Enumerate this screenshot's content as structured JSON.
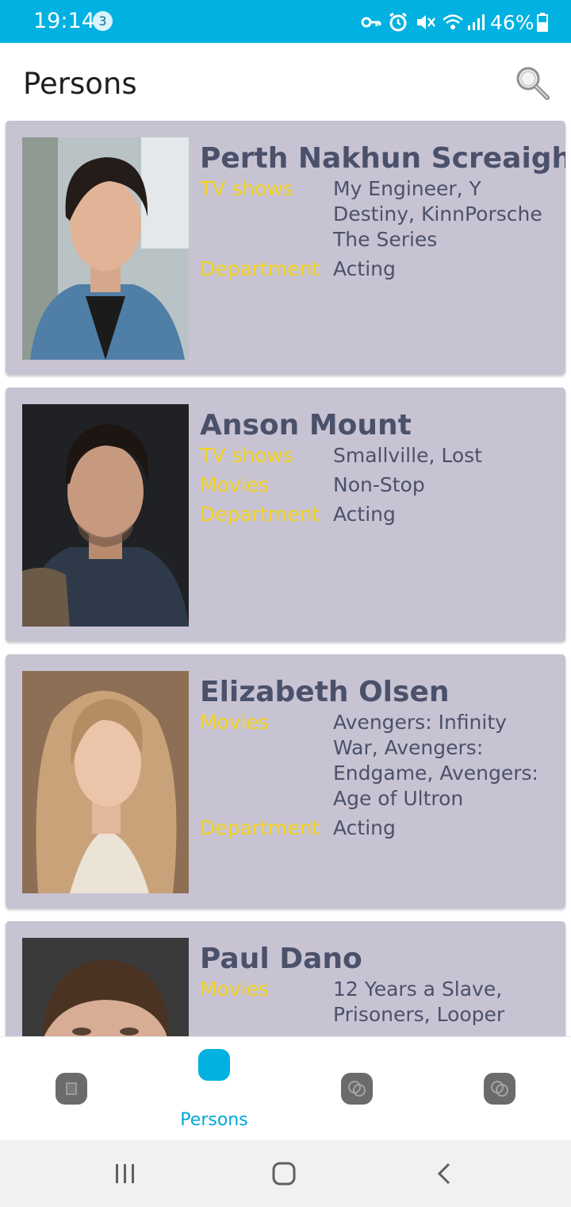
{
  "status_bar": {
    "time": "19:14",
    "notification_count": "3",
    "battery": "46%"
  },
  "header": {
    "title": "Persons",
    "search_icon": "search-icon"
  },
  "persons": [
    {
      "name": "Perth Nakhun Screaigh",
      "rows": [
        {
          "label": "TV shows",
          "value": "My Engineer, Y Destiny, KinnPorsche The Series"
        },
        {
          "label": "Department",
          "value": "Acting"
        }
      ]
    },
    {
      "name": "Anson Mount",
      "rows": [
        {
          "label": "TV shows",
          "value": "Smallville, Lost"
        },
        {
          "label": "Movies",
          "value": "Non-Stop"
        },
        {
          "label": "Department",
          "value": "Acting"
        }
      ]
    },
    {
      "name": "Elizabeth Olsen",
      "rows": [
        {
          "label": "Movies",
          "value": "Avengers: Infinity War, Avengers: Endgame, Avengers: Age of Ultron"
        },
        {
          "label": "Department",
          "value": "Acting"
        }
      ]
    },
    {
      "name": "Paul Dano",
      "rows": [
        {
          "label": "Movies",
          "value": "12 Years a Slave, Prisoners, Looper"
        }
      ]
    }
  ],
  "bottom_nav": {
    "items": [
      {
        "icon": "film-icon",
        "label": ""
      },
      {
        "icon": "person-icon",
        "label": "Persons"
      },
      {
        "icon": "theater-masks-icon",
        "label": ""
      },
      {
        "icon": "theater-masks-icon",
        "label": ""
      }
    ],
    "active_index": 1
  },
  "colors": {
    "accent": "#00b1e1",
    "card_background": "#c8c3d2",
    "label": "#f5d41f",
    "text": "#4b516b"
  }
}
